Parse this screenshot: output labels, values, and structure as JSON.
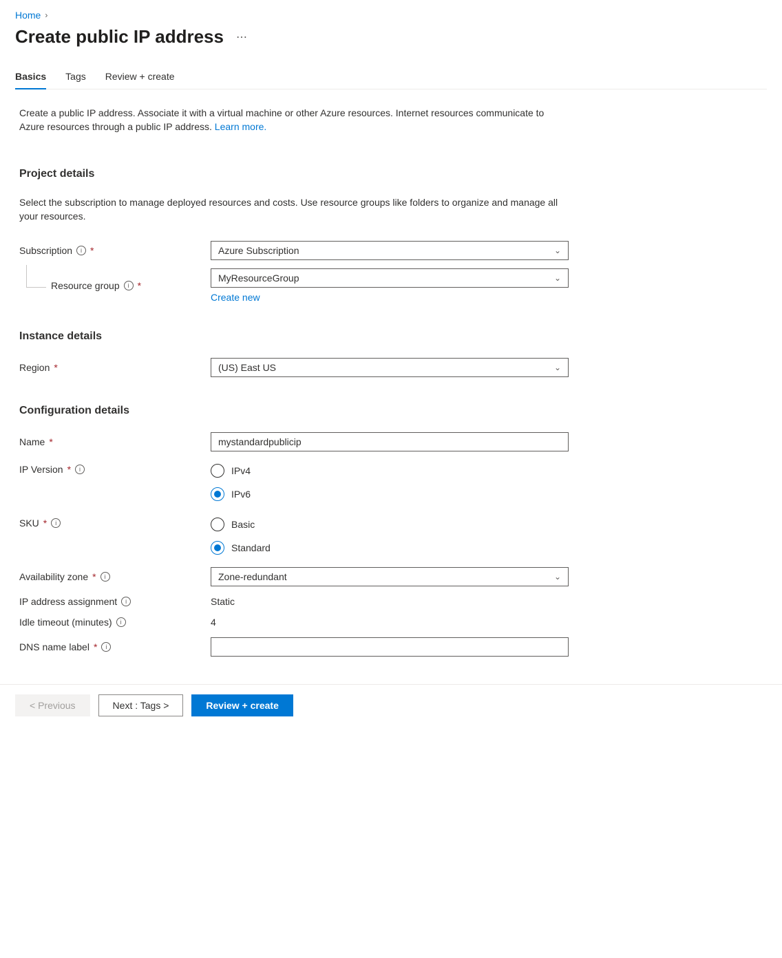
{
  "breadcrumb": {
    "home": "Home"
  },
  "title": "Create public IP address",
  "tabs": {
    "basics": "Basics",
    "tags": "Tags",
    "review": "Review + create"
  },
  "intro": {
    "text": "Create a public IP address. Associate it with a virtual machine or other Azure resources. Internet resources communicate to Azure resources through a public IP address. ",
    "link": "Learn more."
  },
  "project": {
    "heading": "Project details",
    "desc": "Select the subscription to manage deployed resources and costs. Use resource groups like folders to organize and manage all your resources.",
    "subscription_label": "Subscription",
    "subscription_value": "Azure Subscription",
    "rg_label": "Resource group",
    "rg_value": "MyResourceGroup",
    "create_new": "Create new"
  },
  "instance": {
    "heading": "Instance details",
    "region_label": "Region",
    "region_value": "(US) East US"
  },
  "config": {
    "heading": "Configuration details",
    "name_label": "Name",
    "name_value": "mystandardpublicip",
    "ipversion_label": "IP Version",
    "ipv4": "IPv4",
    "ipv6": "IPv6",
    "sku_label": "SKU",
    "basic": "Basic",
    "standard": "Standard",
    "az_label": "Availability zone",
    "az_value": "Zone-redundant",
    "assign_label": "IP address assignment",
    "assign_value": "Static",
    "idle_label": "Idle timeout (minutes)",
    "idle_value": "4",
    "dns_label": "DNS name label",
    "dns_value": ""
  },
  "footer": {
    "previous": "< Previous",
    "next": "Next : Tags >",
    "review": "Review + create"
  }
}
